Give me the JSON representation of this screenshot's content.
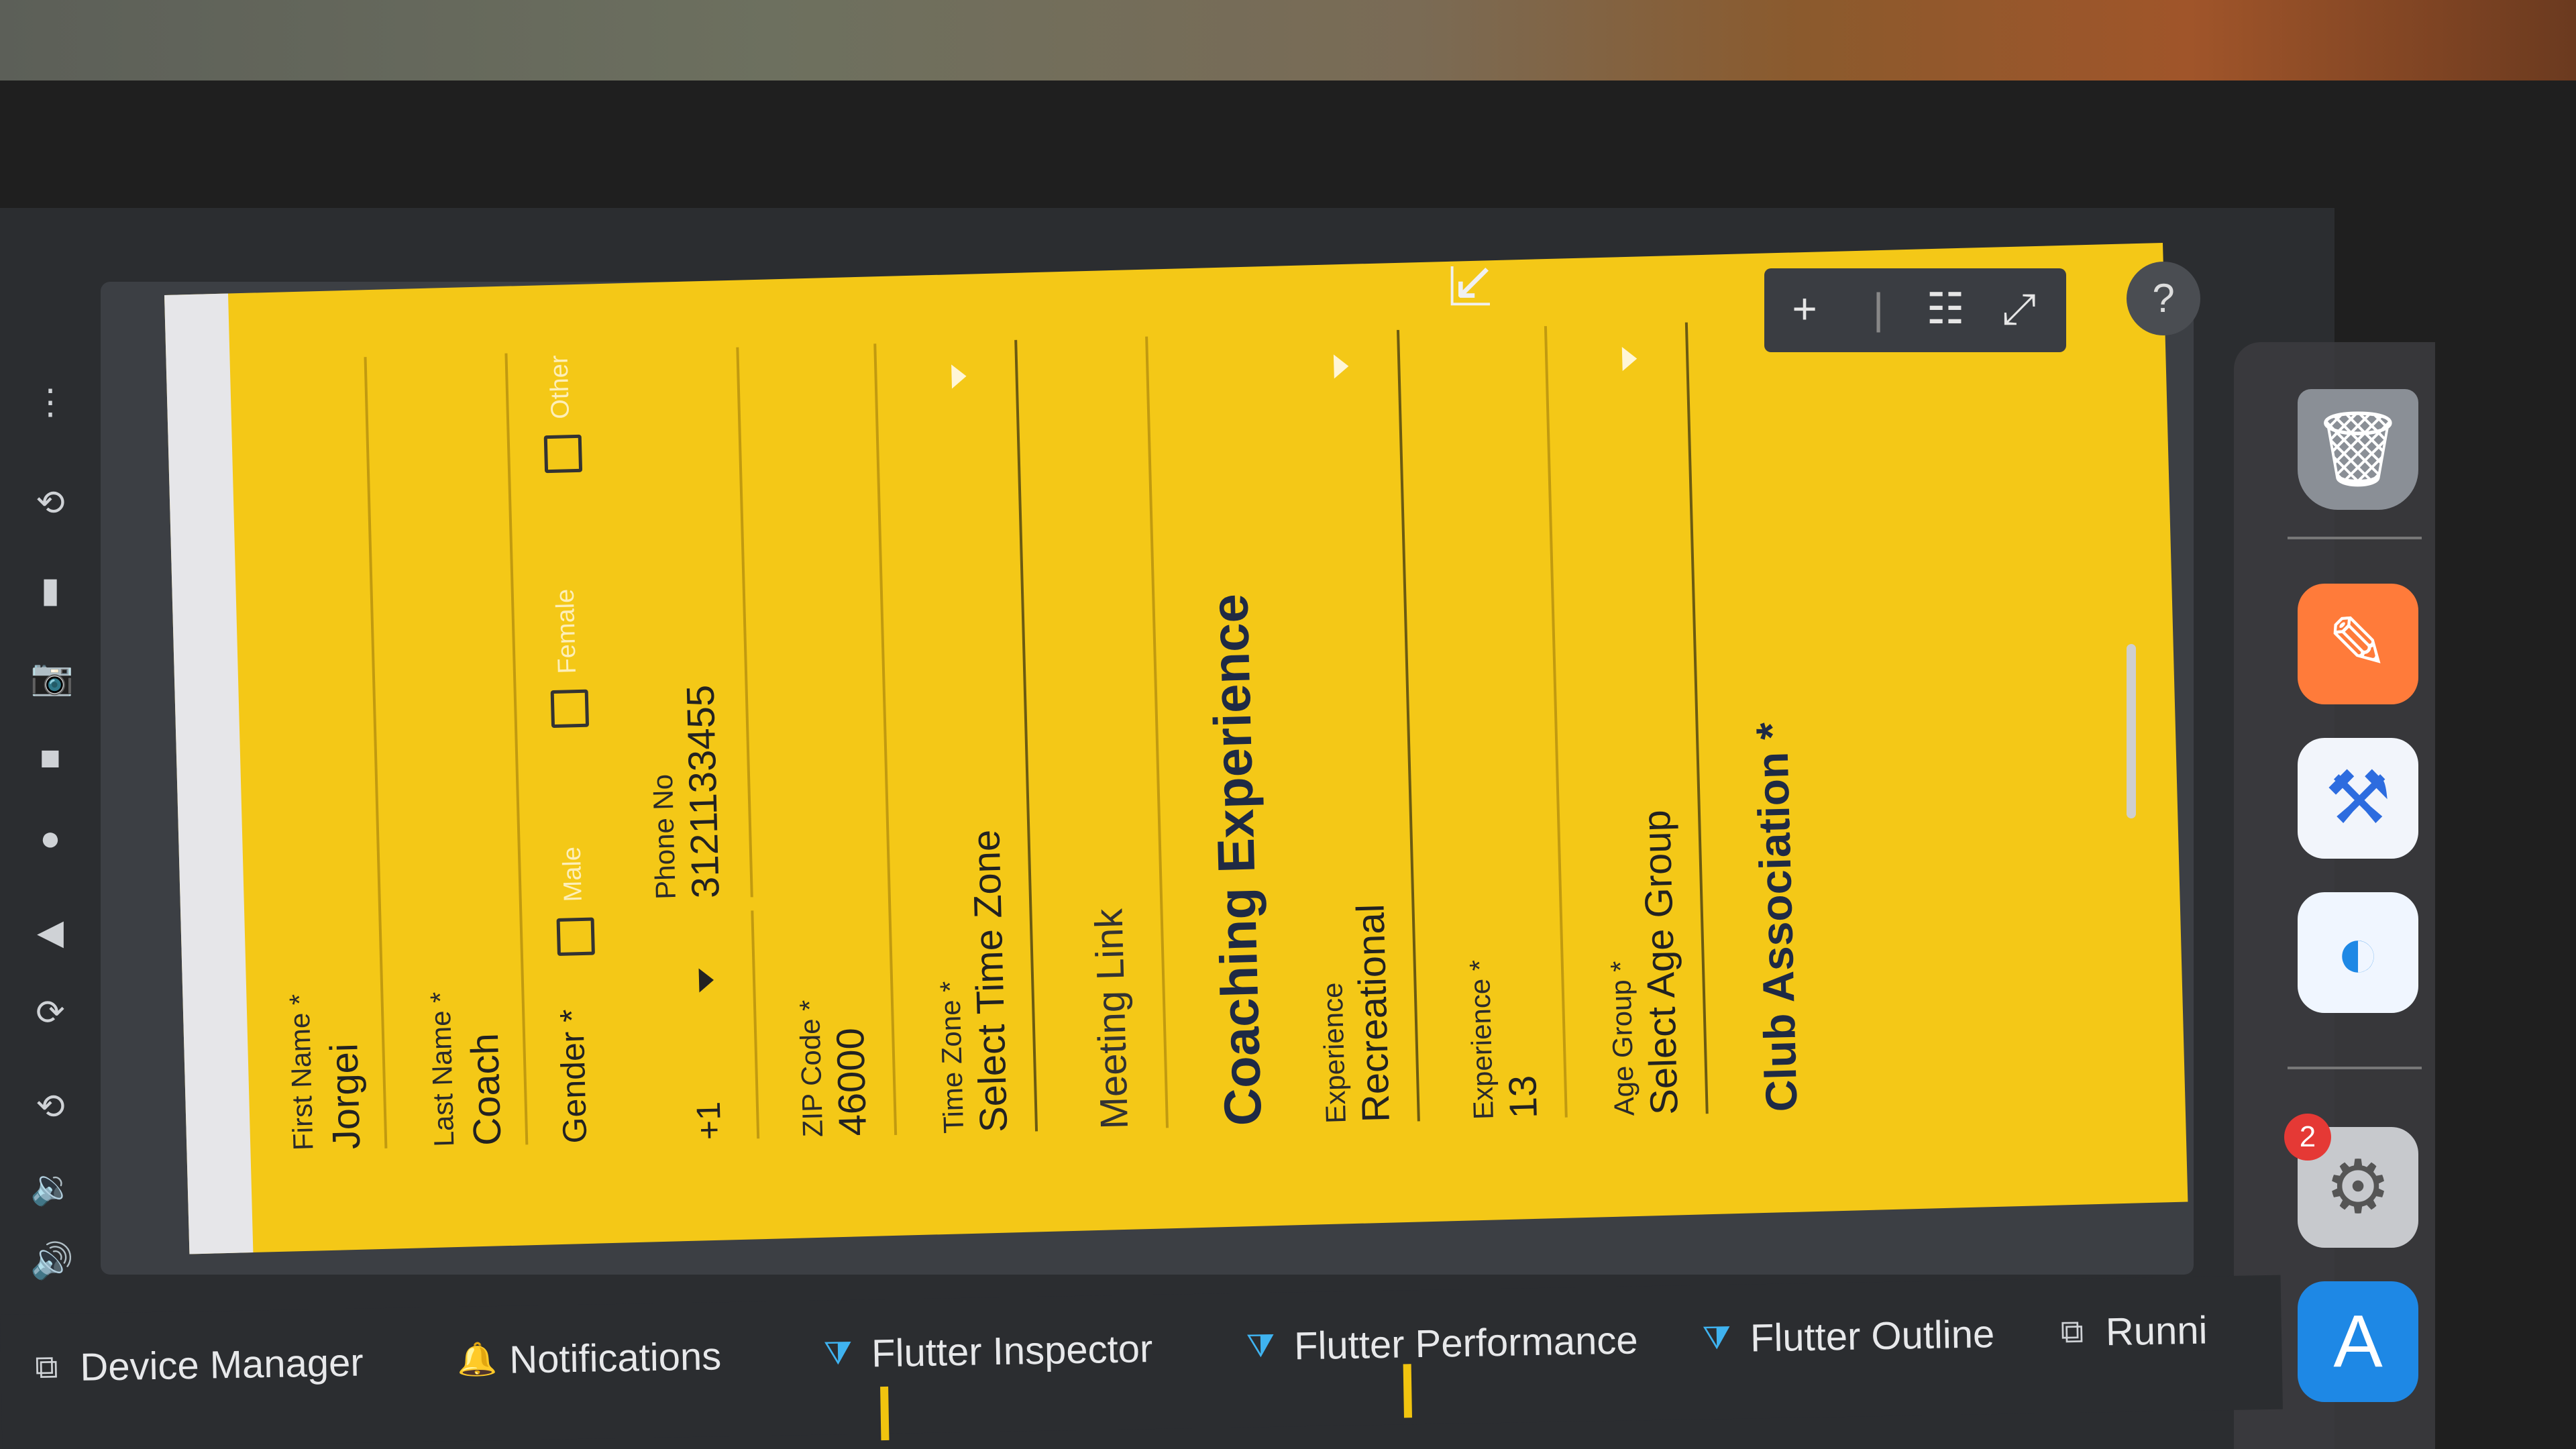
{
  "form": {
    "first_name": {
      "label": "First Name *",
      "value": "Jorgei"
    },
    "last_name": {
      "label": "Last Name *",
      "value": "Coach"
    },
    "gender": {
      "label": "Gender *",
      "options": [
        "Male",
        "Female",
        "Other"
      ]
    },
    "phone": {
      "country_code": "+1",
      "label": "Phone No",
      "value": "3121133455"
    },
    "zip": {
      "label": "ZIP Code *",
      "value": "46000"
    },
    "time_zone": {
      "label": "Time Zone *",
      "value": "Select Time Zone"
    },
    "meeting_link": {
      "placeholder": "Meeting Link"
    },
    "coaching_heading": "Coaching Experience",
    "experience": {
      "label": "Experience",
      "value": "Recreational"
    },
    "experience_years": {
      "label": "Experience *",
      "value": "13"
    },
    "age_group": {
      "label": "Age Group *",
      "value": "Select Age Group"
    },
    "club_heading": "Club Association *"
  },
  "mini_toolbar": {
    "add": "+",
    "sep": "|",
    "list": "☷",
    "expand": "⤢"
  },
  "bottom_tabs": [
    {
      "label": "Device Manager",
      "icon": "device-manager-icon"
    },
    {
      "label": "Notifications",
      "icon": "notifications-icon"
    },
    {
      "label": "Flutter Inspector",
      "icon": "flutter-icon"
    },
    {
      "label": "Flutter Performance",
      "icon": "flutter-icon"
    },
    {
      "label": "Flutter Outline",
      "icon": "flutter-icon"
    },
    {
      "label": "Runni",
      "icon": "run-icon"
    }
  ],
  "dock": {
    "badge": "2"
  },
  "help": "?"
}
